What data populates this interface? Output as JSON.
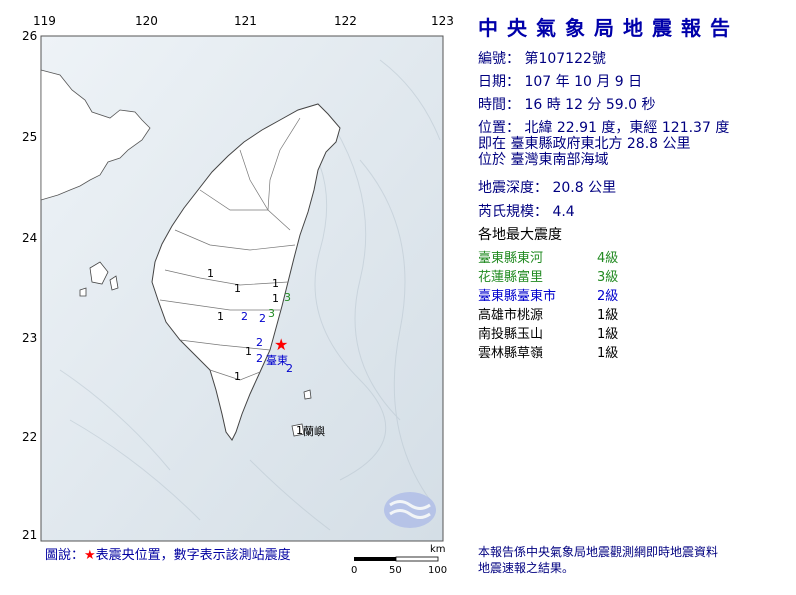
{
  "header": {
    "title": "中央氣象局地震報告"
  },
  "report": {
    "number": "編號： 第107122號",
    "date": "日期： 107 年 10 月 9 日",
    "time": "時間： 16 時 12 分 59.0 秒",
    "location": "位置： 北緯 22.91 度，東經 121.37 度",
    "location_ref": "即在 臺東縣政府東北方 28.8 公里",
    "location_region": "位於 臺灣東南部海域",
    "depth": "地震深度： 20.8 公里",
    "magnitude": "芮氏規模： 4.4",
    "intensity_heading": "各地最大震度"
  },
  "stations": [
    {
      "name": "臺東縣東河",
      "level": "4級",
      "color": "#228b22"
    },
    {
      "name": "花蓮縣富里",
      "level": "3級",
      "color": "#228b22"
    },
    {
      "name": "臺東縣臺東市",
      "level": "2級",
      "color": "#0000cd"
    },
    {
      "name": "高雄市桃源",
      "level": "1級",
      "color": "#000000"
    },
    {
      "name": "南投縣玉山",
      "level": "1級",
      "color": "#000000"
    },
    {
      "name": "雲林縣草嶺",
      "level": "1級",
      "color": "#000000"
    }
  ],
  "map": {
    "lon_ticks": [
      "119",
      "120",
      "121",
      "122",
      "123"
    ],
    "lat_ticks": [
      "26",
      "25",
      "24",
      "23",
      "22",
      "21"
    ],
    "place_labels": {
      "taitung": "臺東",
      "lanyu": "蘭嶼"
    },
    "map_markers": [
      {
        "value": "1",
        "color": "#000000"
      },
      {
        "value": "1",
        "color": "#000000"
      },
      {
        "value": "1",
        "color": "#000000"
      },
      {
        "value": "1",
        "color": "#000000"
      },
      {
        "value": "1",
        "color": "#000000"
      },
      {
        "value": "2",
        "color": "#0000cd"
      },
      {
        "value": "2",
        "color": "#0000cd"
      },
      {
        "value": "3",
        "color": "#228b22"
      },
      {
        "value": "3",
        "color": "#228b22"
      },
      {
        "value": "2",
        "color": "#0000cd"
      },
      {
        "value": "1",
        "color": "#000000"
      },
      {
        "value": "2",
        "color": "#0000cd"
      },
      {
        "value": "2",
        "color": "#0000cd"
      },
      {
        "value": "1",
        "color": "#000000"
      },
      {
        "value": "1",
        "color": "#000000"
      }
    ]
  },
  "legend": {
    "label": "圖說：",
    "star": "★",
    "text": "表震央位置，數字表示該測站震度"
  },
  "scale": {
    "unit": "km",
    "ticks": [
      "0",
      "50",
      "100"
    ]
  },
  "footer": {
    "line1": "本報告係中央氣象局地震觀測網即時地震資料",
    "line2": "地震速報之結果。"
  },
  "colors": {
    "title": "#0000aa",
    "text": "#000080",
    "sea": "#dfe9f0",
    "epicenter": "#ff0000"
  }
}
